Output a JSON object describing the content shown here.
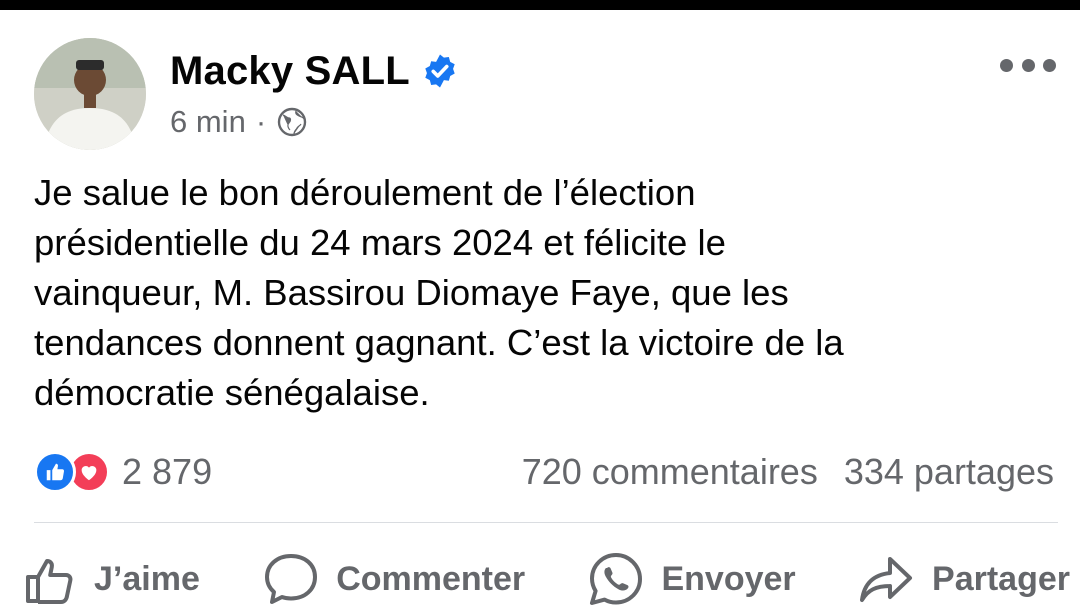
{
  "post": {
    "author": "Macky SALL",
    "time": "6 min",
    "separator": "·",
    "text": "Je salue le bon déroulement de l’élection\nprésidentielle du 24 mars 2024 et félicite le\nvainqueur, M. Bassirou Diomaye Faye, que les\ntendances donnent gagnant. C’est la victoire de la\ndémocratie sénégalaise.",
    "reaction_count": "2 879",
    "comments": "720 commentaires",
    "shares": "334 partages",
    "icons": {
      "verified": "verified-badge-icon",
      "privacy": "globe-icon",
      "more": "more-options-icon",
      "like": "like-reaction-icon",
      "love": "love-reaction-icon"
    }
  },
  "actions": {
    "like": "J’aime",
    "comment": "Commenter",
    "send": "Envoyer",
    "share": "Partager"
  },
  "colors": {
    "text": "#050505",
    "secondary": "#65676b",
    "facebook_blue": "#1877f2",
    "love_red": "#f33e58"
  }
}
